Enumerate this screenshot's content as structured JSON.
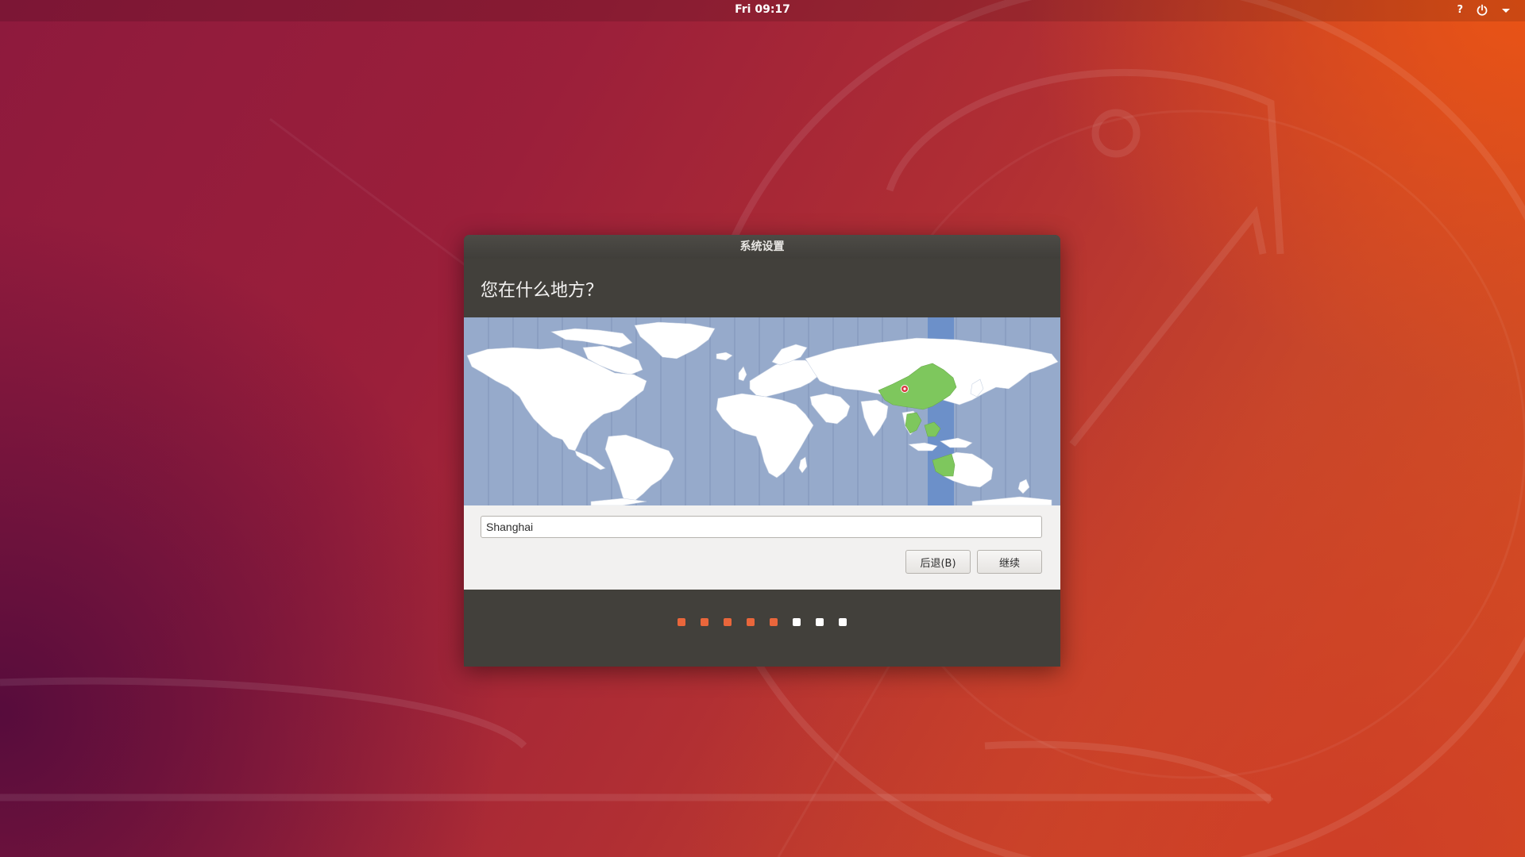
{
  "topbar": {
    "clock": "Fri 09:17",
    "help_label": "?",
    "power_icon": "power-icon",
    "menu_icon": "chevron-down-icon"
  },
  "window": {
    "title": "系统设置",
    "heading": "您在什么地方？",
    "location": {
      "value": "Shanghai"
    },
    "buttons": {
      "back": "后退(B)",
      "continue": "继续"
    },
    "progress": {
      "total_steps": 8,
      "completed_steps": 5,
      "active_color": "#e9663b",
      "inactive_color": "#ffffff"
    }
  },
  "map": {
    "ocean_color": "#96aacb",
    "land_color": "#ffffff",
    "selected_region_color": "#7ec75d",
    "highlight_band_color": "#6c90c9",
    "marker_color": "#d8373f"
  }
}
